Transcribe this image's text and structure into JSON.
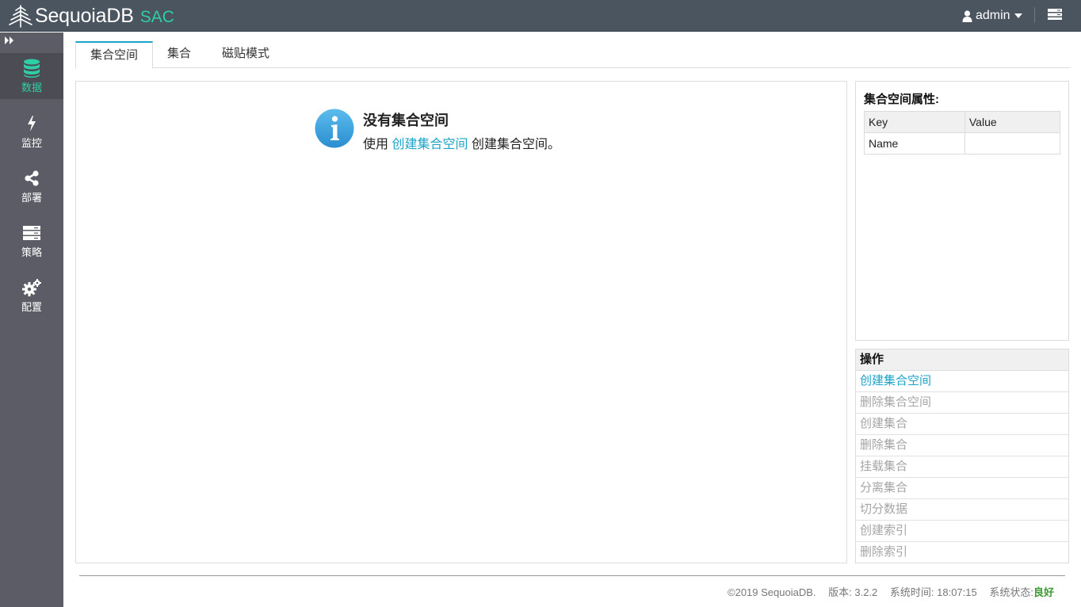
{
  "header": {
    "brand": "SequoiaDB",
    "brand_suffix": "SAC",
    "user": "admin",
    "logo_icon": "sequoia-tree-icon",
    "menu_icon": "server-list-icon"
  },
  "sidebar": {
    "toggle_icon": "double-chevron-right-icon",
    "items": [
      {
        "label": "数据",
        "icon": "database-icon",
        "active": true
      },
      {
        "label": "监控",
        "icon": "bolt-icon",
        "active": false
      },
      {
        "label": "部署",
        "icon": "share-nodes-icon",
        "active": false
      },
      {
        "label": "策略",
        "icon": "server-stack-icon",
        "active": false
      },
      {
        "label": "配置",
        "icon": "gears-icon",
        "active": false
      }
    ]
  },
  "tabs": [
    {
      "label": "集合空间",
      "active": true
    },
    {
      "label": "集合",
      "active": false
    },
    {
      "label": "磁贴模式",
      "active": false
    }
  ],
  "main": {
    "empty_title": "没有集合空间",
    "empty_prefix": "使用",
    "empty_link": "创建集合空间",
    "empty_suffix": "创建集合空间。"
  },
  "properties": {
    "title": "集合空间属性:",
    "columns": [
      "Key",
      "Value"
    ],
    "rows": [
      [
        "Name",
        ""
      ]
    ]
  },
  "operations": {
    "title": "操作",
    "items": [
      {
        "label": "创建集合空间",
        "enabled": true
      },
      {
        "label": "删除集合空间",
        "enabled": false
      },
      {
        "label": "创建集合",
        "enabled": false
      },
      {
        "label": "删除集合",
        "enabled": false
      },
      {
        "label": "挂载集合",
        "enabled": false
      },
      {
        "label": "分离集合",
        "enabled": false
      },
      {
        "label": "切分数据",
        "enabled": false
      },
      {
        "label": "创建索引",
        "enabled": false
      },
      {
        "label": "删除索引",
        "enabled": false
      }
    ]
  },
  "footer": {
    "copyright": "©2019 SequoiaDB.",
    "version": "版本: 3.2.2",
    "time": "系统时间: 18:07:15",
    "status_label": "系统状态:",
    "status_value": "良好"
  },
  "colors": {
    "accent": "#1ca3c7",
    "brand_green": "#2fcfa6",
    "header_bg": "#4a5560",
    "sidebar_bg": "#5c5c66",
    "status_good": "#3a9a32"
  }
}
